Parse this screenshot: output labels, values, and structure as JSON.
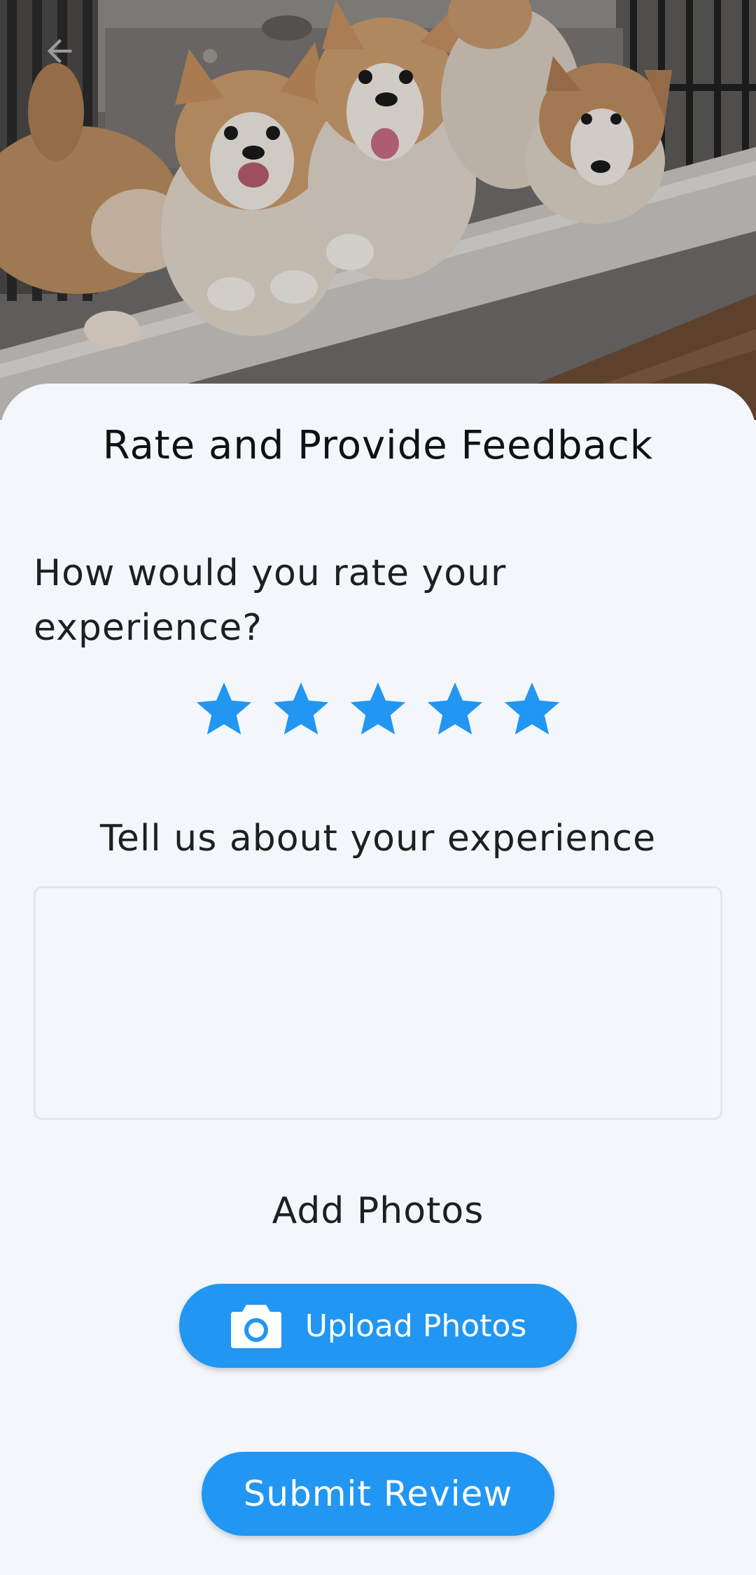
{
  "hero": {
    "image": "puppies-photo",
    "back_icon": "arrow-left-icon"
  },
  "sheet": {
    "title": "Rate and Provide Feedback",
    "rating_question": "How would you rate your experience?",
    "rating": {
      "value": 5,
      "max": 5,
      "star_icon": "star-icon",
      "color": "#2196f3"
    },
    "experience_label": "Tell us about your experience",
    "experience_value": "",
    "photos_label": "Add Photos",
    "upload_button_label": "Upload Photos",
    "upload_icon": "camera-icon",
    "submit_button_label": "Submit Review"
  },
  "colors": {
    "accent": "#2196f3",
    "background": "#f3f7fc",
    "text": "#1f1f1f"
  }
}
